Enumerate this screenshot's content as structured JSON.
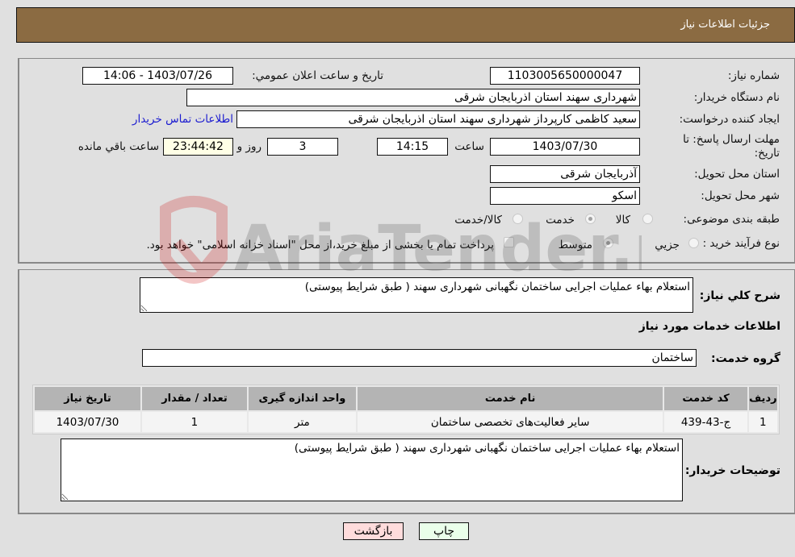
{
  "header": {
    "title": "جزئیات اطلاعات نیاز"
  },
  "form": {
    "need_number": {
      "label": "شماره نیاز:",
      "value": "1103005650000047"
    },
    "announce_datetime": {
      "label": "تاریخ و ساعت اعلان عمومي:",
      "value": "1403/07/26 - 14:06"
    },
    "buyer_org": {
      "label": "نام دستگاه خریدار:",
      "value": "شهرداری سهند استان اذربایجان شرقی"
    },
    "requester": {
      "label": "ایجاد کننده درخواست:",
      "value": "سعید کاظمی کارپرداز شهرداری سهند استان اذربایجان شرقی"
    },
    "contact_link": "اطلاعات تماس خریدار",
    "deadline": {
      "label_line1": "مهلت ارسال پاسخ: تا",
      "label_line2": "تاریخ:",
      "date": "1403/07/30",
      "time_label": "ساعت",
      "time": "14:15",
      "days": "3",
      "days_label": "روز و",
      "remaining": "23:44:42",
      "remaining_label": "ساعت باقي مانده"
    },
    "province": {
      "label": "استان محل تحویل:",
      "value": "آذربایجان شرقی"
    },
    "city": {
      "label": "شهر محل تحویل:",
      "value": "اسکو"
    },
    "category": {
      "label": "طبقه بندی موضوعی:",
      "options": [
        "کالا",
        "خدمت",
        "کالا/خدمت"
      ],
      "selected": "خدمت"
    },
    "purchase_type": {
      "label": "نوع فرآیند خرید :",
      "options": [
        "جزیي",
        "متوسط"
      ],
      "selected": "متوسط",
      "treasury_note": "پرداخت تمام یا بخشی از مبلغ خرید،از محل \"اسناد خزانه اسلامی\" خواهد بود.",
      "treasury_checked": false
    }
  },
  "details": {
    "summary_label": "شرح کلي نیاز:",
    "summary_value": "استعلام بهاء عملیات اجرایی ساختمان نگهبانی شهرداری سهند ( طبق شرایط پیوستی)",
    "services_heading": "اطلاعات خدمات مورد نیاز",
    "service_group_label": "گروه خدمت:",
    "service_group_value": "ساختمان",
    "table": {
      "headers": [
        "ردیف",
        "کد خدمت",
        "نام خدمت",
        "واحد اندازه گیری",
        "تعداد / مقدار",
        "تاریخ نیاز"
      ],
      "rows": [
        [
          "1",
          "ج-43-439",
          "سایر فعالیت‌های تخصصی ساختمان",
          "متر",
          "1",
          "1403/07/30"
        ]
      ]
    },
    "buyer_notes_label": "توضیحات خریدار:",
    "buyer_notes_value": "استعلام بهاء عملیات اجرایی ساختمان نگهبانی شهرداری سهند ( طبق شرایط پیوستی)"
  },
  "buttons": {
    "print": "چاپ",
    "back": "بازگشت"
  },
  "watermark_text": "AriaTender.neT"
}
